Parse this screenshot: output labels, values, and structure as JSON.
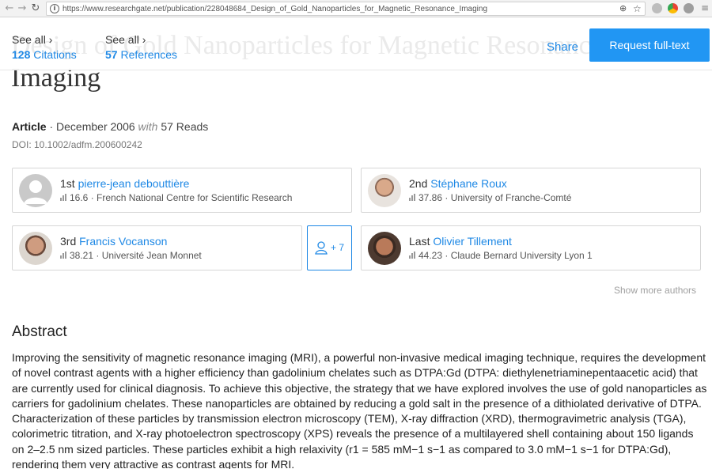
{
  "browser": {
    "url": "https://www.researchgate.net/publication/228048684_Design_of_Gold_Nanoparticles_for_Magnetic_Resonance_Imaging",
    "icons": [
      "back-arrow-icon",
      "forward-arrow-icon",
      "reload-icon",
      "info-icon",
      "zoom-icon",
      "star-icon",
      "menu-icon"
    ]
  },
  "header": {
    "citations_see_all": "See all ›",
    "citations_count": "128",
    "citations_label": "Citations",
    "references_see_all": "See all ›",
    "references_count": "57",
    "references_label": "References",
    "ghost_title": "Design of Gold Nanoparticles for Magnetic Resonance Imaging",
    "share_label": "Share",
    "request_label": "Request full-text",
    "accent": "#2196f3"
  },
  "publication": {
    "title_tail": "Imaging",
    "type": "Article",
    "date": "December 2006",
    "with": "with",
    "reads": "57 Reads",
    "doi": "DOI: 10.1002/adfm.200600242"
  },
  "authors": [
    {
      "position": "1st",
      "name": "pierre-jean debouttière",
      "score": "16.6",
      "affiliation": "French National Centre for Scientific Research"
    },
    {
      "position": "2nd",
      "name": "Stéphane Roux",
      "score": "37.86",
      "affiliation": "University of Franche-Comté"
    },
    {
      "position": "3rd",
      "name": "Francis Vocanson",
      "score": "38.21",
      "affiliation": "Université Jean Monnet"
    },
    {
      "position": "Last",
      "name": "Olivier Tillement",
      "score": "44.23",
      "affiliation": "Claude Bernard University Lyon 1"
    }
  ],
  "more_authors": {
    "label": "+ 7"
  },
  "show_more_authors": "Show more authors",
  "abstract": {
    "heading": "Abstract",
    "text": "Improving the sensitivity of magnetic resonance imaging (MRI), a powerful non-invasive medical imaging technique, requires the development of novel contrast agents with a higher efficiency than gadolinium chelates such as DTPA:Gd (DTPA: diethylenetriaminepentaacetic acid) that are currently used for clinical diagnosis. To achieve this objective, the strategy that we have explored involves the use of gold nanoparticles as carriers for gadolinium chelates. These nanoparticles are obtained by reducing a gold salt in the presence of a dithiolated derivative of DTPA. Characterization of these particles by transmission electron microscopy (TEM), X-ray diffraction (XRD), thermogravimetric analysis (TGA), colorimetric titration, and X-ray photoelectron spectroscopy (XPS) reveals the presence of a multilayered shell containing about 150 ligands on 2–2.5 nm sized particles. These particles exhibit a high relaxivity (r1 = 585 mM−1 s−1 as compared to 3.0 mM−1 s−1 for DTPA:Gd), rendering them very attractive as contrast agents for MRI."
  }
}
